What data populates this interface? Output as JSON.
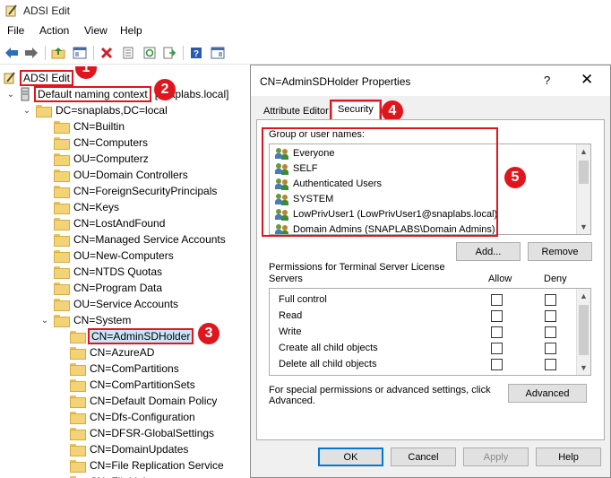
{
  "window": {
    "title": "ADSI Edit"
  },
  "menu": [
    "File",
    "Action",
    "View",
    "Help"
  ],
  "tree": {
    "root": "ADSI Edit",
    "context": "Default naming context",
    "context_suffix": "[snaplabs.local]",
    "domain": "DC=snaplabs,DC=local",
    "children": [
      "CN=Builtin",
      "CN=Computers",
      "OU=Computerz",
      "OU=Domain Controllers",
      "CN=ForeignSecurityPrincipals",
      "CN=Keys",
      "CN=LostAndFound",
      "CN=Managed Service Accounts",
      "OU=New-Computers",
      "CN=NTDS Quotas",
      "CN=Program Data",
      "OU=Service Accounts"
    ],
    "system": "CN=System",
    "system_children": [
      "CN=AdminSDHolder",
      "CN=AzureAD",
      "CN=ComPartitions",
      "CN=ComPartitionSets",
      "CN=Default Domain Policy",
      "CN=Dfs-Configuration",
      "CN=DFSR-GlobalSettings",
      "CN=DomainUpdates",
      "CN=File Replication Service",
      "CN=FileLinks"
    ]
  },
  "badges": [
    "1",
    "2",
    "3",
    "4",
    "5"
  ],
  "dialog": {
    "title": "CN=AdminSDHolder Properties",
    "help": "?",
    "close": "✕",
    "tabs": [
      "Attribute Editor",
      "Security"
    ],
    "group_label": "Group or user names:",
    "users": [
      "Everyone",
      "SELF",
      "Authenticated Users",
      "SYSTEM",
      "LowPrivUser1 (LowPrivUser1@snaplabs.local)",
      "Domain Admins (SNAPLABS\\Domain Admins)"
    ],
    "add_label": "Add...",
    "remove_label": "Remove",
    "perm_label_1": "Permissions for Terminal Server License",
    "perm_label_2": "Servers",
    "allow_label": "Allow",
    "deny_label": "Deny",
    "permissions": [
      "Full control",
      "Read",
      "Write",
      "Create all child objects",
      "Delete all child objects"
    ],
    "special_1": "For special permissions or advanced settings, click",
    "special_2": "Advanced.",
    "advanced_label": "Advanced",
    "ok_label": "OK",
    "cancel_label": "Cancel",
    "apply_label": "Apply",
    "help_label": "Help"
  },
  "colors": {
    "highlight": "#e0161f",
    "folder": "#f3d377",
    "accent": "#0078d7"
  }
}
